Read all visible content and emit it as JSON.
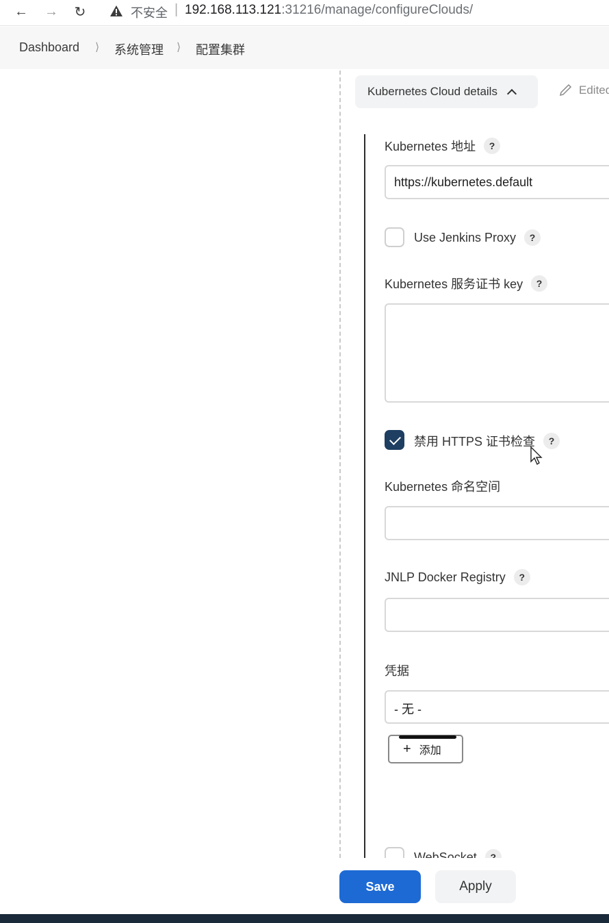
{
  "browser": {
    "insecure_label": "不安全",
    "url_host": "192.168.113.121",
    "url_rest": ":31216/manage/configureClouds/"
  },
  "breadcrumb": {
    "items": [
      {
        "label": "Dashboard"
      },
      {
        "label": "系统管理"
      },
      {
        "label": "配置集群"
      }
    ]
  },
  "section": {
    "toggle_label": "Kubernetes Cloud details",
    "edited_label": "Edited"
  },
  "form": {
    "k8s_url_label": "Kubernetes 地址",
    "k8s_url_value": "https://kubernetes.default",
    "use_proxy_label": "Use Jenkins Proxy",
    "use_proxy_checked": false,
    "server_cert_label": "Kubernetes 服务证书 key",
    "disable_https_label": "禁用 HTTPS 证书检查",
    "disable_https_checked": true,
    "namespace_label": "Kubernetes 命名空间",
    "namespace_value": "",
    "jnlp_registry_label": "JNLP Docker Registry",
    "jnlp_registry_value": "",
    "credentials_label": "凭据",
    "credentials_value": "- 无 -",
    "add_button_label": "添加",
    "websocket_label": "WebSocket",
    "help_glyph": "?"
  },
  "actions": {
    "save_label": "Save",
    "apply_label": "Apply"
  },
  "colors": {
    "primary": "#1d6ad4",
    "checkbox_checked": "#1e3e62"
  }
}
